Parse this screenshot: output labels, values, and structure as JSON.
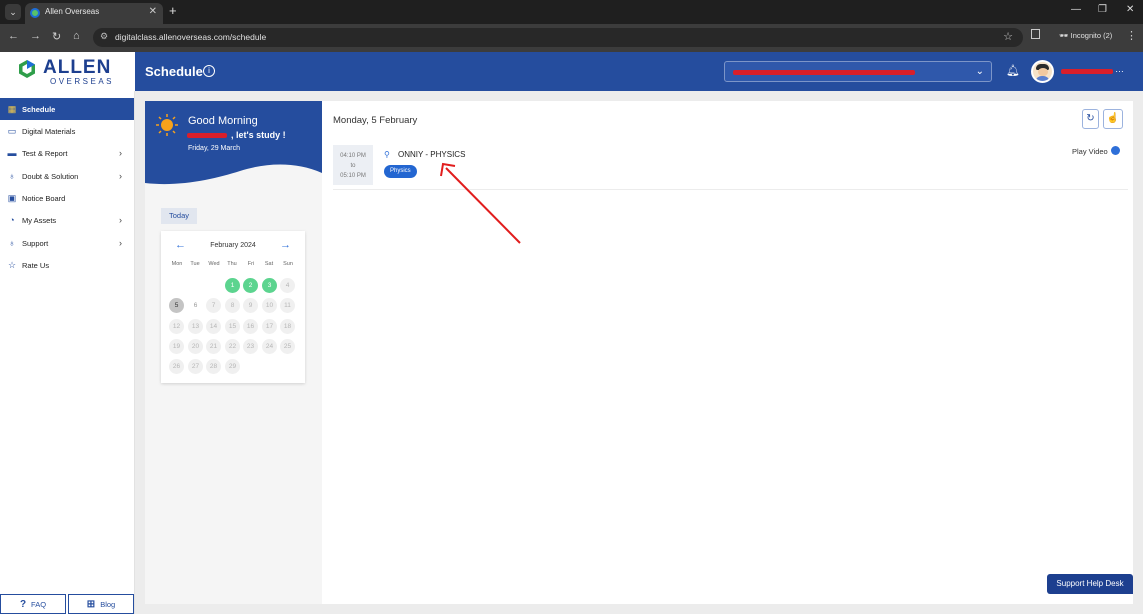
{
  "browser": {
    "tab_title": "Allen Overseas",
    "url": "digitalclass.allenoverseas.com/schedule",
    "incognito_label": "Incognito (2)"
  },
  "brand": {
    "name": "ALLEN",
    "sub": "OVERSEAS"
  },
  "header": {
    "title": "Schedule",
    "info_symbol": "i"
  },
  "sidebar": {
    "items": [
      {
        "label": "Schedule",
        "icon": "calendar-icon"
      },
      {
        "label": "Digital Materials",
        "icon": "book-icon"
      },
      {
        "label": "Test & Report",
        "icon": "monitor-icon"
      },
      {
        "label": "Doubt & Solution",
        "icon": "bulb-icon"
      },
      {
        "label": "Notice Board",
        "icon": "board-icon"
      },
      {
        "label": "My Assets",
        "icon": "gauge-icon"
      },
      {
        "label": "Support",
        "icon": "support-icon"
      },
      {
        "label": "Rate Us",
        "icon": "star-icon"
      }
    ],
    "footer": {
      "faq": "FAQ",
      "blog": "Blog"
    }
  },
  "greeting": {
    "title": "Good Morning",
    "subtitle": ", let's study !",
    "date": "Friday, 29 March"
  },
  "calendar": {
    "today_label": "Today",
    "month": "February 2024",
    "weekdays": [
      "Mon",
      "Tue",
      "Wed",
      "Thu",
      "Fri",
      "Sat",
      "Sun"
    ],
    "days_row1": [
      "1",
      "2",
      "3",
      "4"
    ],
    "days_row2": [
      "5",
      "6",
      "7",
      "8",
      "9",
      "10",
      "11"
    ],
    "days_row3": [
      "12",
      "13",
      "14",
      "15",
      "16",
      "17",
      "18"
    ],
    "days_row4": [
      "19",
      "20",
      "21",
      "22",
      "23",
      "24",
      "25"
    ],
    "days_row5": [
      "26",
      "27",
      "28",
      "29"
    ],
    "colors": {
      "available": "#5cd48f",
      "selected": "#c4c4c4"
    }
  },
  "schedule": {
    "date_heading": "Monday, 5 February",
    "session": {
      "start": "04:10 PM",
      "to": "to",
      "end": "05:10 PM",
      "title": "ONNIY - PHYSICS",
      "subject": "Physics",
      "play_video": "Play Video"
    }
  },
  "help_desk": "Support Help Desk",
  "colors": {
    "brand_blue": "#254d9e",
    "annotation_red": "#e11d1d"
  }
}
